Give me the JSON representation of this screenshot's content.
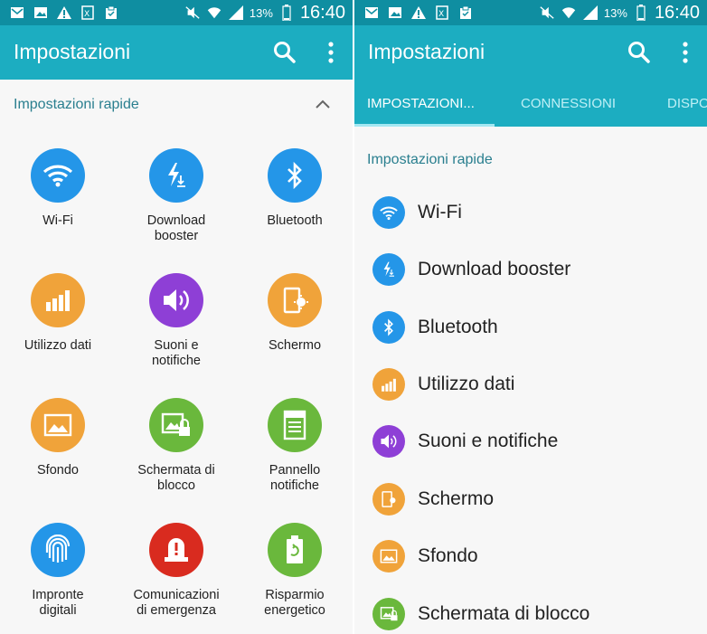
{
  "colors": {
    "status_bar": "#0f8ea1",
    "action_bar": "#1cadc1",
    "section_title": "#2a7f8f",
    "blue": "#2496e8",
    "orange": "#f0a33a",
    "purple": "#8e3fd6",
    "green": "#6ab83c",
    "red": "#d92b1f"
  },
  "status_bar": {
    "battery_percent": "13%",
    "time": "16:40",
    "icons": [
      "email-icon",
      "image-icon",
      "alert-icon",
      "excel-icon",
      "clipboard-icon",
      "mute-icon",
      "wifi-icon",
      "signal-icon",
      "battery-icon"
    ]
  },
  "app": {
    "title": "Impostazioni"
  },
  "tabs": [
    "IMPOSTAZIONI...",
    "CONNESSIONI",
    "DISPO"
  ],
  "section": {
    "title": "Impostazioni rapide"
  },
  "grid_items": [
    {
      "label_line1": "Wi-Fi",
      "label_line2": "",
      "icon": "wifi-icon",
      "color": "blue"
    },
    {
      "label_line1": "Download",
      "label_line2": "booster",
      "icon": "download-booster-icon",
      "color": "blue"
    },
    {
      "label_line1": "Bluetooth",
      "label_line2": "",
      "icon": "bluetooth-icon",
      "color": "blue"
    },
    {
      "label_line1": "Utilizzo dati",
      "label_line2": "",
      "icon": "data-usage-icon",
      "color": "orange"
    },
    {
      "label_line1": "Suoni e",
      "label_line2": "notifiche",
      "icon": "sound-icon",
      "color": "purple"
    },
    {
      "label_line1": "Schermo",
      "label_line2": "",
      "icon": "display-icon",
      "color": "orange"
    },
    {
      "label_line1": "Sfondo",
      "label_line2": "",
      "icon": "wallpaper-icon",
      "color": "orange"
    },
    {
      "label_line1": "Schermata di",
      "label_line2": "blocco",
      "icon": "lock-screen-icon",
      "color": "green"
    },
    {
      "label_line1": "Pannello",
      "label_line2": "notifiche",
      "icon": "notification-panel-icon",
      "color": "green"
    },
    {
      "label_line1": "Impronte",
      "label_line2": "digitali",
      "icon": "fingerprint-icon",
      "color": "blue"
    },
    {
      "label_line1": "Comunicazioni",
      "label_line2": "di emergenza",
      "icon": "emergency-icon",
      "color": "red"
    },
    {
      "label_line1": "Risparmio",
      "label_line2": "energetico",
      "icon": "power-saving-icon",
      "color": "green"
    }
  ],
  "list_items": [
    {
      "label": "Wi-Fi",
      "icon": "wifi-icon",
      "color": "blue"
    },
    {
      "label": "Download booster",
      "icon": "download-booster-icon",
      "color": "blue"
    },
    {
      "label": "Bluetooth",
      "icon": "bluetooth-icon",
      "color": "blue"
    },
    {
      "label": "Utilizzo dati",
      "icon": "data-usage-icon",
      "color": "orange"
    },
    {
      "label": "Suoni e notifiche",
      "icon": "sound-icon",
      "color": "purple"
    },
    {
      "label": "Schermo",
      "icon": "display-icon",
      "color": "orange"
    },
    {
      "label": "Sfondo",
      "icon": "wallpaper-icon",
      "color": "orange"
    },
    {
      "label": "Schermata di blocco",
      "icon": "lock-screen-icon",
      "color": "green"
    }
  ]
}
